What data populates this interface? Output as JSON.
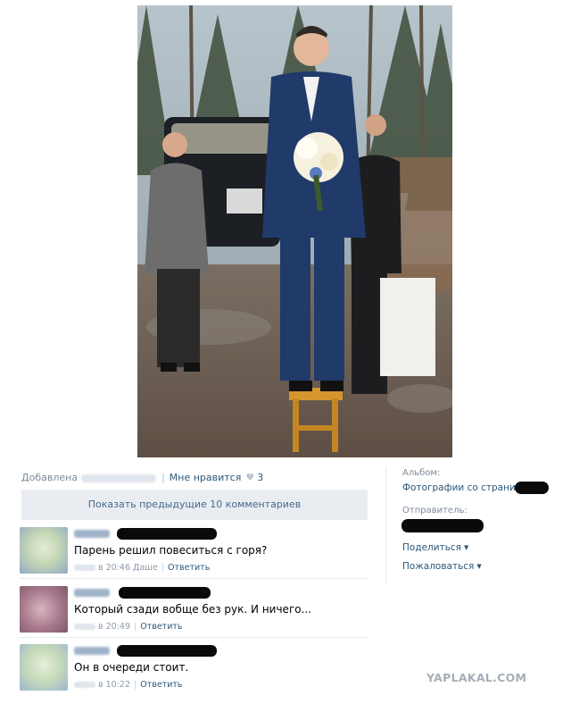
{
  "post": {
    "added_label": "Добавлена",
    "like_label": "Мне нравится",
    "like_count": "3"
  },
  "show_previous": "Показать предыдущие 10 комментариев",
  "comments": [
    {
      "text": "Парень решил повеситься с горя?",
      "time": "в 20:46",
      "extra": "Даше",
      "reply_label": "Ответить",
      "avatar_color": "#bcd0a8"
    },
    {
      "text": "Который сзади вобще без рук. И ничего...",
      "time": "в 20:49",
      "extra": "",
      "reply_label": "Ответить",
      "avatar_color": "#b58c9a"
    },
    {
      "text": "Он в очереди стоит.",
      "time": "в 10:22",
      "extra": "",
      "reply_label": "Ответить",
      "avatar_color": "#b9cfb1"
    }
  ],
  "sidebar": {
    "album_label": "Альбом:",
    "album_link": "Фотографии со страницы",
    "sender_label": "Отправитель:",
    "share_label": "Поделиться",
    "report_label": "Пожаловаться"
  },
  "watermark": "YAPLAKAL.COM",
  "icons": {
    "heart": "heart-icon",
    "dropdown": "caret-down-icon"
  },
  "colors": {
    "link": "#2b587a",
    "button_bg": "#e9edf1",
    "meta": "#7b8a99"
  }
}
